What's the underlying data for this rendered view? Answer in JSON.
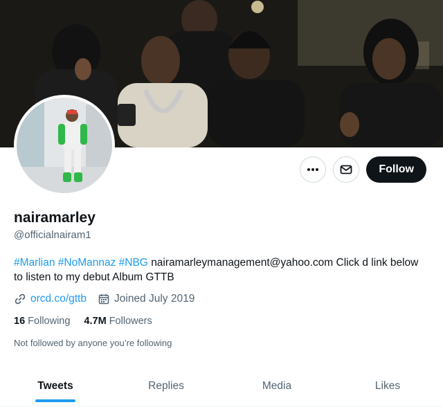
{
  "profile": {
    "display_name": "nairamarley",
    "handle": "@officialnairam1",
    "bio": {
      "hashtags": [
        "#Marlian",
        "#NoMannaz",
        "#NBG"
      ],
      "text": "nairamarleymanagement@yahoo.com Click d link below to listen to my debut Album GTTB"
    },
    "link": "orcd.co/gttb",
    "joined": "Joined July 2019",
    "following_count": "16",
    "following_label": "Following",
    "followers_count": "4.7M",
    "followers_label": "Followers",
    "not_followed_note": "Not followed by anyone you’re following"
  },
  "actions": {
    "more_icon": "more-icon",
    "message_icon": "envelope-icon",
    "follow_label": "Follow"
  },
  "tabs": [
    {
      "label": "Tweets",
      "active": true
    },
    {
      "label": "Replies",
      "active": false
    },
    {
      "label": "Media",
      "active": false
    },
    {
      "label": "Likes",
      "active": false
    }
  ],
  "colors": {
    "accent": "#1d9bf0",
    "text_primary": "#0f1419",
    "text_secondary": "#536471",
    "follow_bg": "#0f1419"
  }
}
